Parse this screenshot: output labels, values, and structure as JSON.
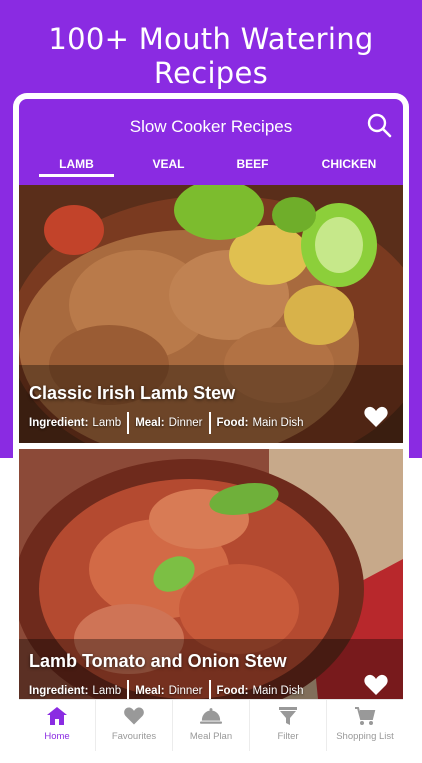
{
  "promo": {
    "title": "100+ Mouth Watering Recipes"
  },
  "header": {
    "title": "Slow Cooker Recipes",
    "search_icon": "search-icon"
  },
  "tabs": [
    {
      "label": "LAMB",
      "active": true
    },
    {
      "label": "VEAL",
      "active": false
    },
    {
      "label": "BEEF",
      "active": false
    },
    {
      "label": "CHICKEN",
      "active": false
    }
  ],
  "recipes": [
    {
      "title": "Classic Irish Lamb Stew",
      "ingredient_label": "Ingredient:",
      "ingredient": "Lamb",
      "meal_label": "Meal:",
      "meal": "Dinner",
      "food_label": "Food:",
      "food": "Main Dish",
      "favorite_icon": "heart-icon"
    },
    {
      "title": "Lamb Tomato and Onion Stew",
      "ingredient_label": "Ingredient:",
      "ingredient": "Lamb",
      "meal_label": "Meal:",
      "meal": "Dinner",
      "food_label": "Food:",
      "food": "Main Dish",
      "favorite_icon": "heart-icon"
    }
  ],
  "nav": [
    {
      "label": "Home",
      "icon": "home-icon",
      "active": true
    },
    {
      "label": "Favourites",
      "icon": "heart-icon",
      "active": false
    },
    {
      "label": "Meal Plan",
      "icon": "cloche-icon",
      "active": false
    },
    {
      "label": "Filter",
      "icon": "filter-icon",
      "active": false
    },
    {
      "label": "Shopping List",
      "icon": "cart-icon",
      "active": false
    }
  ],
  "colors": {
    "brand": "#8a2be2",
    "inactive": "#999999"
  }
}
